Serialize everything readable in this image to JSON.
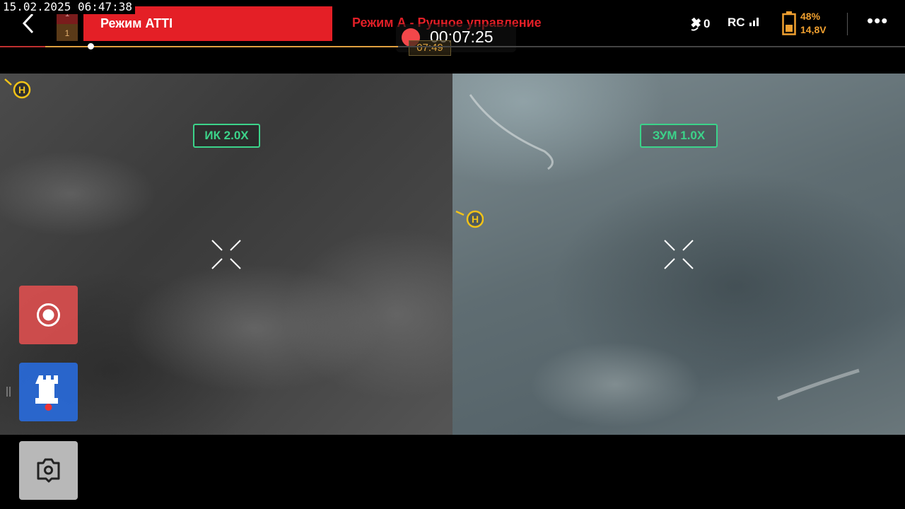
{
  "header": {
    "timestamp": "15.02.2025 06:47:38",
    "mini_map": {
      "top": "1",
      "bottom": "1"
    },
    "flight_mode": "Режим ATTI",
    "control_mode": "Режим А - Ручное управление",
    "recording_time": "00:07:25",
    "elapsed_time": "07:49",
    "satellite_count": "0",
    "rc_label": "RC",
    "battery_percent": "48%",
    "battery_voltage": "14,8V",
    "more_label": "•••",
    "progress_fraction": 0.44,
    "progress_buffer_fraction": 0.05,
    "progress_knob_fraction": 0.1
  },
  "feeds": {
    "ir": {
      "zoom_label": "ИК  2.0X",
      "home_label": "H"
    },
    "zoom": {
      "zoom_label": "ЗУМ  1.0X",
      "home_label": "H"
    }
  },
  "controls": {
    "record_button_icon": "record-icon",
    "tower_button_icon": "tower-icon",
    "screenshot_button_icon": "camera-icon"
  },
  "colors": {
    "accent_red": "#e41f26",
    "label_green": "#3cd38a",
    "home_yellow": "#f2c318",
    "battery_orange": "#f0a030"
  }
}
